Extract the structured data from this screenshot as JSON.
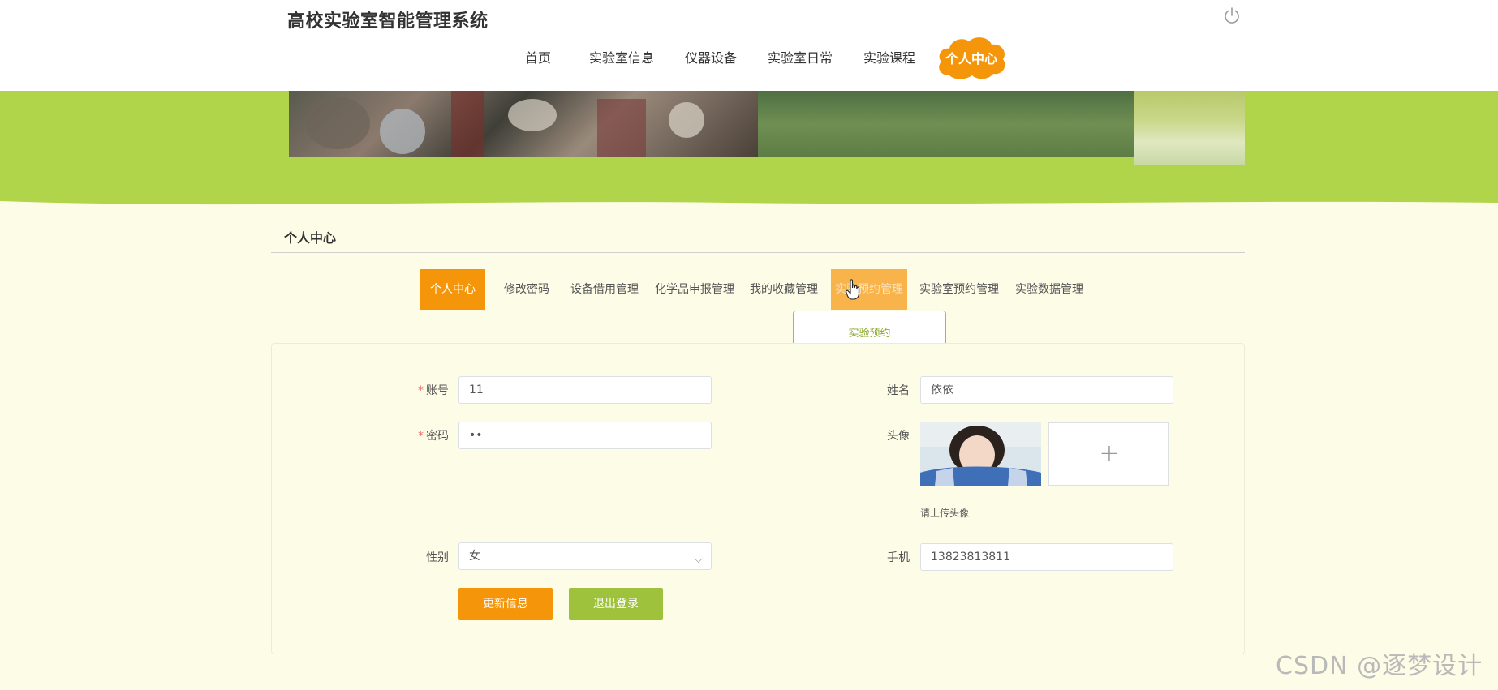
{
  "header": {
    "title": "高校实验室智能管理系统",
    "logout_icon": "power-icon"
  },
  "nav": {
    "items": [
      "首页",
      "实验室信息",
      "仪器设备",
      "实验室日常",
      "实验课程"
    ],
    "active": "个人中心",
    "active_color": "#f5960a"
  },
  "section": {
    "title": "个人中心"
  },
  "tabs": {
    "items": [
      "个人中心",
      "修改密码",
      "设备借用管理",
      "化学品申报管理",
      "我的收藏管理",
      "实验预约管理",
      "实验室预约管理",
      "实验数据管理"
    ],
    "active_index": 0,
    "hover_index": 5
  },
  "dropdown": {
    "items": [
      "实验预约"
    ]
  },
  "form": {
    "account_label": "账号",
    "account_value": "11",
    "password_label": "密码",
    "password_value": "••",
    "name_label": "姓名",
    "name_value": "依依",
    "avatar_label": "头像",
    "avatar_hint": "请上传头像",
    "gender_label": "性别",
    "gender_value": "女",
    "phone_label": "手机",
    "phone_value": "13823813811",
    "required_mark": "*"
  },
  "buttons": {
    "update": "更新信息",
    "logout": "退出登录"
  },
  "colors": {
    "accent_orange": "#f5960a",
    "accent_green": "#9ec23c",
    "banner_green": "#b0d44a",
    "page_bg": "#fdfce6"
  },
  "watermark": "CSDN @逐梦设计"
}
